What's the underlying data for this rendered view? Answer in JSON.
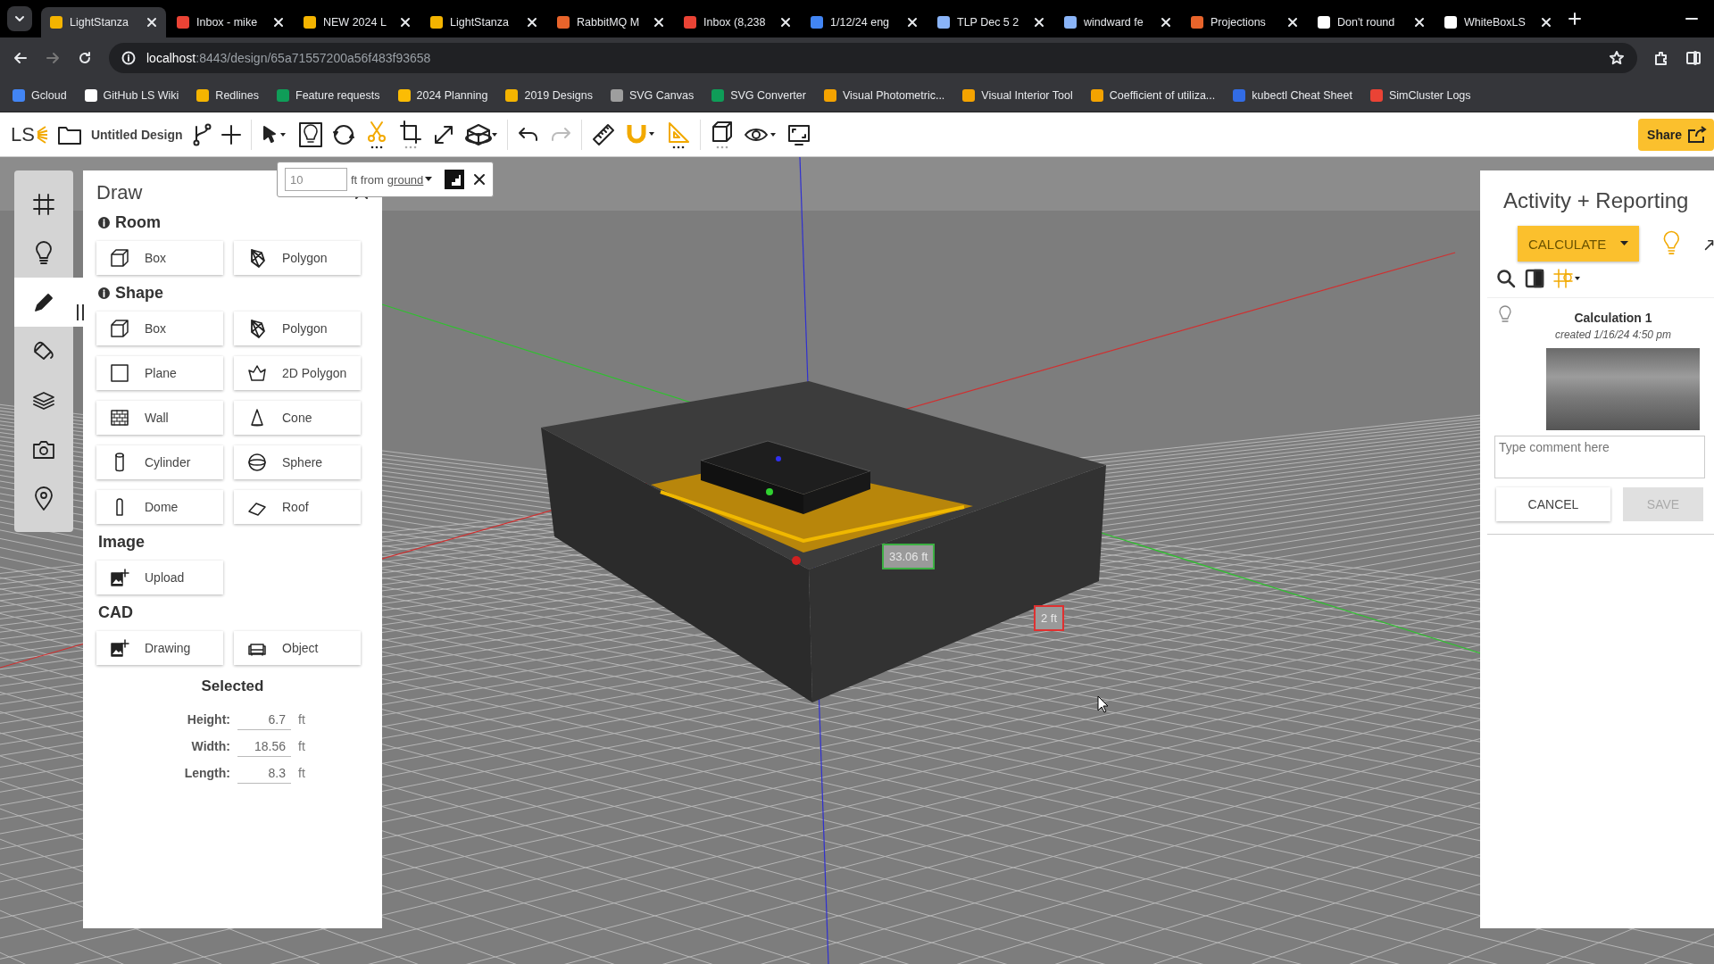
{
  "browser": {
    "tabs": [
      {
        "title": "LightStanza",
        "selected": true,
        "color": "#f4b400"
      },
      {
        "title": "Inbox - mike",
        "selected": false,
        "color": "#ea4335"
      },
      {
        "title": "NEW 2024 L",
        "selected": false,
        "color": "#f4b400"
      },
      {
        "title": "LightStanza",
        "selected": false,
        "color": "#f4b400"
      },
      {
        "title": "RabbitMQ M",
        "selected": false,
        "color": "#e8642b"
      },
      {
        "title": "Inbox (8,238",
        "selected": false,
        "color": "#ea4335"
      },
      {
        "title": "1/12/24 eng",
        "selected": false,
        "color": "#4285f4"
      },
      {
        "title": "TLP Dec 5 2",
        "selected": false,
        "color": "#8ab4f8"
      },
      {
        "title": "windward fe",
        "selected": false,
        "color": "#8ab4f8"
      },
      {
        "title": "Projections",
        "selected": false,
        "color": "#e8642b"
      },
      {
        "title": "Don't round",
        "selected": false,
        "color": "#ffffff"
      },
      {
        "title": "WhiteBoxLS",
        "selected": false,
        "color": "#ffffff"
      }
    ],
    "url_host": "localhost",
    "url_rest": ":8443/design/65a71557200a56f483f93658",
    "bookmarks": [
      {
        "title": "Gcloud",
        "color": "#4285f4"
      },
      {
        "title": "GitHub LS Wiki",
        "color": "#ffffff"
      },
      {
        "title": "Redlines",
        "color": "#f4b400"
      },
      {
        "title": "Feature requests",
        "color": "#0f9d58"
      },
      {
        "title": "2024 Planning",
        "color": "#fbbc04"
      },
      {
        "title": "2019 Designs",
        "color": "#f4b400"
      },
      {
        "title": "SVG Canvas",
        "color": "#9e9e9e"
      },
      {
        "title": "SVG Converter",
        "color": "#0f9d58"
      },
      {
        "title": "Visual Photometric...",
        "color": "#f4a300"
      },
      {
        "title": "Visual Interior Tool",
        "color": "#f4a300"
      },
      {
        "title": "Coefficient of utiliza...",
        "color": "#f4a300"
      },
      {
        "title": "kubectl Cheat Sheet",
        "color": "#326ce5"
      },
      {
        "title": "SimCluster Logs",
        "color": "#ea4335"
      }
    ]
  },
  "toolbar": {
    "logo": "LS",
    "design_name": "Untitled Design",
    "share": "Share"
  },
  "height_popup": {
    "value": "10",
    "label": "ft from",
    "reference": "ground"
  },
  "rail": [
    {
      "selected": false
    },
    {
      "selected": false
    },
    {
      "selected": true
    },
    {
      "selected": false
    },
    {
      "selected": false
    },
    {
      "selected": false
    },
    {
      "selected": false
    }
  ],
  "draw_panel": {
    "title": "Draw",
    "sections": [
      {
        "title": "Room",
        "info": true,
        "buttons": [
          "Box",
          "Polygon"
        ]
      },
      {
        "title": "Shape",
        "info": true,
        "buttons": [
          "Box",
          "Polygon",
          "Plane",
          "2D Polygon",
          "Wall",
          "Cone",
          "Cylinder",
          "Sphere",
          "Dome",
          "Roof"
        ]
      },
      {
        "title": "Image",
        "info": false,
        "buttons": [
          "Upload"
        ]
      },
      {
        "title": "CAD",
        "info": false,
        "buttons": [
          "Drawing",
          "Object"
        ]
      }
    ],
    "selected": {
      "title": "Selected",
      "fields": [
        {
          "label": "Height:",
          "value": "6.7",
          "unit": "ft"
        },
        {
          "label": "Width:",
          "value": "18.56",
          "unit": "ft"
        },
        {
          "label": "Length:",
          "value": "8.3",
          "unit": "ft"
        }
      ]
    }
  },
  "scene": {
    "labels": [
      {
        "text": "33.06 ft",
        "color": "#3cb043"
      },
      {
        "text": "2 ft",
        "color": "#e03030"
      }
    ]
  },
  "activity": {
    "title": "Activity + Reporting",
    "calculate": "CALCULATE",
    "calculation": {
      "title": "Calculation 1",
      "created": "created 1/16/24 4:50 pm"
    },
    "comment_placeholder": "Type comment here",
    "cancel": "CANCEL",
    "save": "SAVE",
    "save_disabled": true
  }
}
